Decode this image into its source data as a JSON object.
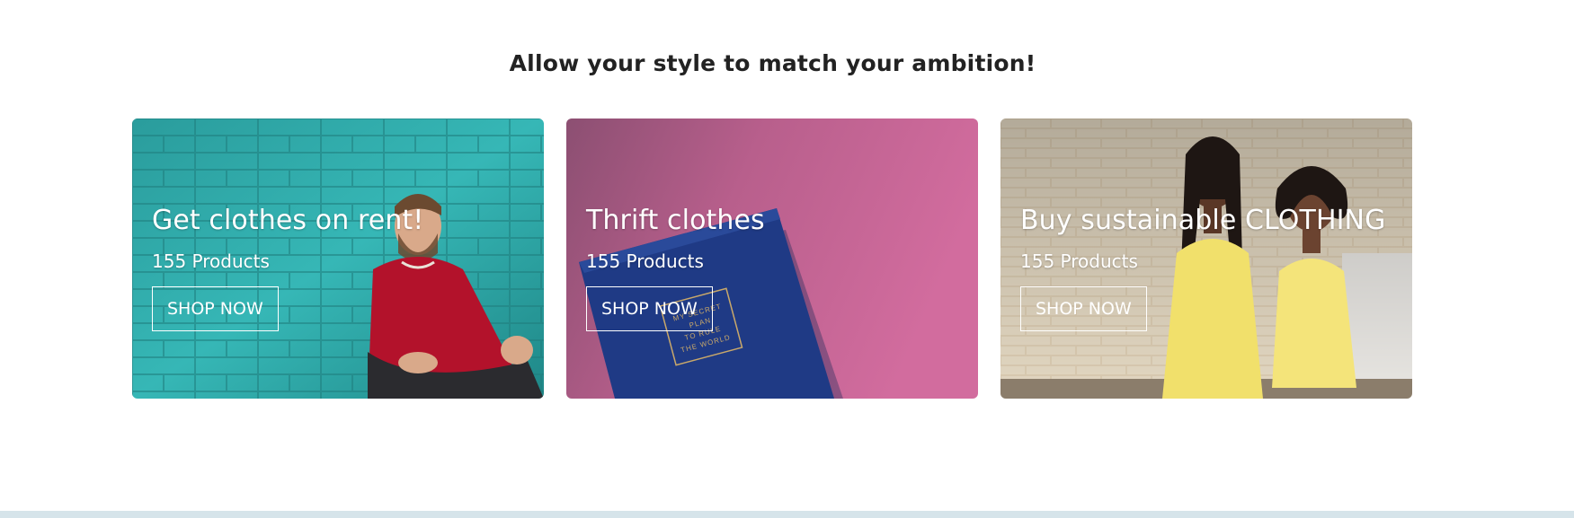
{
  "section": {
    "headline": "Allow your style to match your ambition!"
  },
  "cards": [
    {
      "title": "Get clothes on rent!",
      "count": "155 Products",
      "button": "SHOP NOW"
    },
    {
      "title": "Thrift clothes",
      "count": "155 Products",
      "button": "SHOP NOW"
    },
    {
      "title": "Buy sustainable CLOTHING",
      "count": "155 Products",
      "button": "SHOP NOW"
    }
  ],
  "notebook_print": "MY SECRET PLAN TO RULE THE WORLD",
  "colors": {
    "teal_bg": "#2fb3b3",
    "pink_bg": "#d26c9e",
    "navy_book": "#1f3a85",
    "sweater_red": "#b3122b",
    "dress_yellow": "#f1e06b",
    "brick_beige": "#e6d6bb",
    "footer_strip": "#d6e4ea"
  }
}
